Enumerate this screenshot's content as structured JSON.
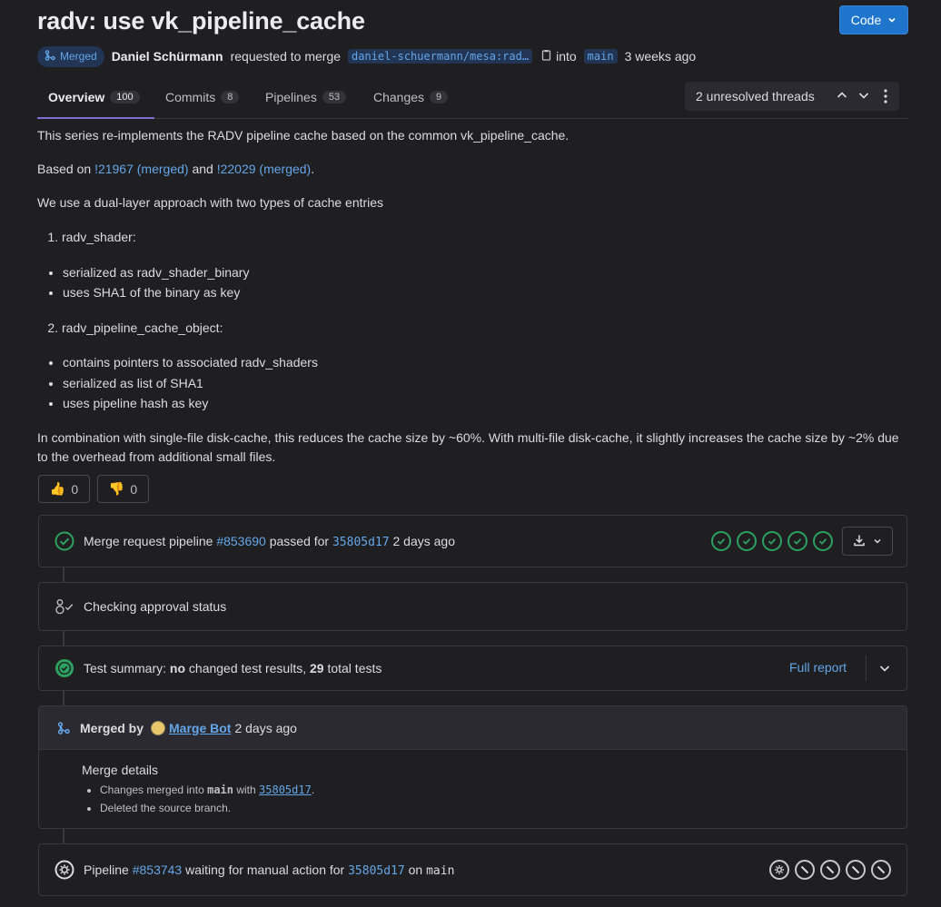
{
  "header": {
    "title": "radv: use vk_pipeline_cache",
    "code_button": "Code"
  },
  "meta": {
    "status_badge": "Merged",
    "author": "Daniel Schürmann",
    "requested_text": "requested to merge",
    "source_branch": "daniel-schuermann/mesa:rad…",
    "into_text": "into",
    "target_branch": "main",
    "time": "3 weeks ago"
  },
  "tabs": [
    {
      "label": "Overview",
      "count": "100"
    },
    {
      "label": "Commits",
      "count": "8"
    },
    {
      "label": "Pipelines",
      "count": "53"
    },
    {
      "label": "Changes",
      "count": "9"
    }
  ],
  "threads": {
    "label": "2 unresolved threads"
  },
  "description": {
    "p1": "This series re-implements the RADV pipeline cache based on the common vk_pipeline_cache.",
    "p2_prefix": "Based on",
    "p2_link1": "!21967 (merged)",
    "p2_and": "and",
    "p2_link2": "!22029 (merged)",
    "p2_suffix": ".",
    "p3": "We use a dual-layer approach with two types of cache entries",
    "item1": "radv_shader:",
    "item1_bullets": [
      "serialized as radv_shader_binary",
      "uses SHA1 of the binary as key"
    ],
    "item2": "radv_pipeline_cache_object:",
    "item2_bullets": [
      "contains pointers to associated radv_shaders",
      "serialized as list of SHA1",
      "uses pipeline hash as key"
    ],
    "p4": "In combination with single-file disk-cache, this reduces the cache size by ~60%. With multi-file disk-cache, it slightly increases the cache size by ~2% due to the overhead from additional small files."
  },
  "reactions": {
    "thumbs_up": "0",
    "thumbs_down": "0"
  },
  "pipeline1": {
    "prefix": "Merge request pipeline",
    "id": "#853690",
    "mid": "passed for",
    "commit": "35805d17",
    "time": "2 days ago"
  },
  "approval": {
    "text": "Checking approval status"
  },
  "tests": {
    "prefix": "Test summary:",
    "no": "no",
    "changed": "changed test results,",
    "total": "29",
    "suffix": "total tests",
    "full_report": "Full report"
  },
  "merged": {
    "label": "Merged by",
    "user": "Marge Bot",
    "time": "2 days ago",
    "details_title": "Merge details",
    "detail1_prefix": "Changes merged into",
    "detail1_branch": "main",
    "detail1_with": "with",
    "detail1_commit": "35805d17",
    "detail1_suffix": ".",
    "detail2": "Deleted the source branch."
  },
  "pipeline2": {
    "prefix": "Pipeline",
    "id": "#853743",
    "mid": "waiting for manual action for",
    "commit": "35805d17",
    "on": "on",
    "branch": "main"
  },
  "colors": {
    "accent": "#1f75cb",
    "link": "#63a6e9",
    "success": "#2da160",
    "background": "#1f1f22"
  }
}
